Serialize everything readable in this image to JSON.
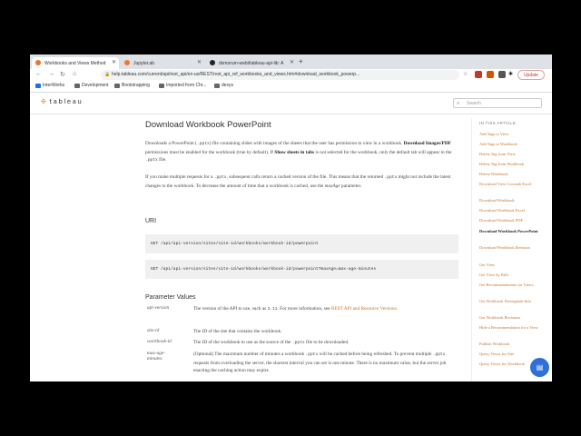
{
  "browser": {
    "tabs": [
      {
        "title": "Workbooks and Views Method",
        "active": true,
        "color": "#e8762d"
      },
      {
        "title": "Jupyter.ab",
        "active": false,
        "color": "#f37726"
      },
      {
        "title": "dxmorum-webi/tableau-api-lib: A",
        "active": false,
        "color": "#222222"
      }
    ],
    "new_tab": "+",
    "url": "help.tableau.com/current/api/rest_api/en-us/REST/rest_api_ref_workbooks_and_views.htm#download_workbook_powerp...",
    "update_label": "Update",
    "bookmarks": [
      "InterWorks",
      "Development",
      "Bootstrapping",
      "Imported from Chr...",
      "dexys"
    ]
  },
  "site": {
    "logo_text": "tableau",
    "search_placeholder": "Search"
  },
  "article": {
    "title": "Download Workbook PowerPoint",
    "para1": {
      "a": "Downloads a PowerPoint (",
      "code1": ".pptx",
      "b": ") file containing slides with images of the sheets that the user has permission to view in a workbook. ",
      "bold1": "Download Images/PDF",
      "c": " permissions must be enabled for the workbook (true by default). If ",
      "bold2": "Show sheets in tabs",
      "d": " is not selected for the workbook, only the default tab will appear in the ",
      "code2": ".pptx",
      "e": " file."
    },
    "para2": {
      "a": "If you make multiple requests for a ",
      "code1": ".pptx",
      "b": ", subsequent calls return a cached version of the file. This means that the returned ",
      "code2": ".pptx",
      "c": " might not include the latest changes to the workbook. To decrease the amount of time that a workbook is cached, use the ",
      "em": "maxAge",
      "d": " parameter."
    },
    "uri_heading": "URI",
    "uri1": "GET /api/api-version/sites/site-id/workbooks/workbook-id/powerpoint",
    "uri2": "GET /api/api-version/sites/site-id/workbooks/workbook-id/powerpoint?maxAge=max-age-minutes",
    "params_heading": "Parameter Values",
    "params": [
      {
        "name": "api-version",
        "desc_a": "The version of the API to use, such as ",
        "desc_code": "3.11",
        "desc_b": ". For more information, see ",
        "desc_link": "REST API and Resource Versions",
        "desc_c": "."
      },
      {
        "name": "site-id",
        "desc": "The ID of the site that contains the workbook."
      },
      {
        "name": "workbook-id",
        "desc_a": "The ID of the workbook to use as the source of the ",
        "desc_code": ".pptx",
        "desc_b": " file to be downloaded."
      },
      {
        "name1": "max-age-",
        "name2": "minutes",
        "desc_a": "(Optional) The maximum number of minutes a workbook ",
        "desc_code": ".pptx",
        "desc_b": " will be cached before being refreshed. To prevent multiple ",
        "desc_code2": ".pptx",
        "desc_c": " requests from overloading the server, the shortest interval you can set is one minute. There is no maximum value, but the server job enacting the caching action may expire"
      }
    ]
  },
  "sidebar": {
    "header": "IN THIS ARTICLE",
    "items": [
      "Add Tags to View",
      "Add Tags to Workbook",
      "Delete Tag from View",
      "Delete Tag from Workbook",
      "Delete Workbook",
      "Download View Crosstab Excel",
      "Download Workbook",
      "Download Workbook Excel",
      "Download Workbook PDF",
      "Download Workbook PowerPoint",
      "Download Workbook Revision",
      "Get View",
      "Get View by Path",
      "Get Recommendations for Views",
      "Get Workbook Downgrade Info",
      "Get Workbook Revisions",
      "Hide a Recommendation for a View",
      "Publish Workbook",
      "Query Views for Site",
      "Query Views for Workbook"
    ],
    "current_index": 9
  }
}
